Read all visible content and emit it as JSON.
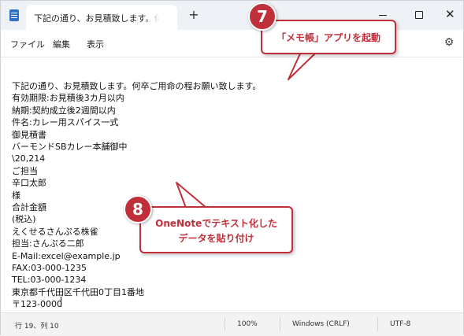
{
  "app": {
    "tab_title": "下記の通り、お見積致します。何卒ご用命の程お願い致します。",
    "new_tab_symbol": "+",
    "window_controls": {
      "minimize": "─",
      "maximize": "□",
      "close": "✕"
    },
    "icon": "notepad-icon"
  },
  "menu": {
    "items": [
      {
        "label": "ファイル"
      },
      {
        "label": "編集"
      },
      {
        "label": "表示"
      }
    ],
    "settings_icon": "gear-icon"
  },
  "document": {
    "lines": [
      "下記の通り、お見積致します。何卒ご用命の程お願い致します。",
      "有効期限:お見積後3カ月以内",
      "納期:契約成立後2週間以内",
      "件名:カレー用スパイス一式",
      "御見積書",
      "バーモンドSBカレー本舗御中",
      "\\20,214",
      "ご担当",
      "辛口太郎",
      "様",
      "合計金額",
      "(税込)",
      "えくせるさんぷる株雀",
      "担当:さんぷる二郎",
      "E-Mail:excel@example.jp",
      "FAX:03-000-1235",
      "TEL:03-000-1234",
      "東京都千代田区千代田0丁目1番地",
      "〒123-0000"
    ]
  },
  "status": {
    "position": "行 19、列 10",
    "zoom": "100%",
    "line_ending": "Windows (CRLF)",
    "encoding": "UTF-8"
  },
  "annotations": {
    "step7": {
      "number": "7",
      "text": "「メモ帳」アプリを起動"
    },
    "step8": {
      "number": "8",
      "line1": "OneNoteでテキスト化した",
      "line2": "データを貼り付け"
    },
    "accent_color": "#c0303a"
  }
}
